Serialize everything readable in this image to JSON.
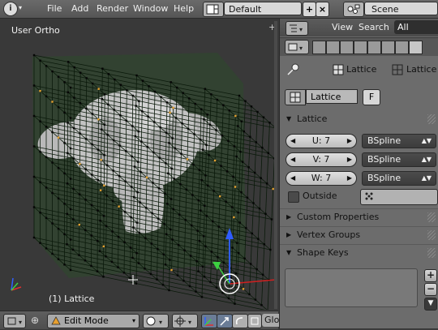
{
  "topbar": {
    "menus": [
      "File",
      "Add",
      "Render",
      "Window",
      "Help"
    ],
    "screen_layout": "Default",
    "add_symbol": "+",
    "remove_symbol": "×",
    "scene": "Scene"
  },
  "viewport": {
    "view_label": "User Ortho",
    "selection_label": "(1) Lattice"
  },
  "viewport_header": {
    "mode": "Edit Mode",
    "truncated_label": "Glo"
  },
  "properties": {
    "header_links": [
      "View",
      "Search"
    ],
    "scenes_button": "All Scenes",
    "breadcrumb": [
      "Lattice",
      "Lattice"
    ],
    "datablock_name": "Lattice",
    "fake_user": "F",
    "panels": {
      "lattice": "Lattice",
      "custom_properties": "Custom Properties",
      "vertex_groups": "Vertex Groups",
      "shape_keys": "Shape Keys"
    },
    "resolution": [
      {
        "label": "U: 7",
        "interp": "BSpline"
      },
      {
        "label": "V: 7",
        "interp": "BSpline"
      },
      {
        "label": "W: 7",
        "interp": "BSpline"
      }
    ],
    "outside_label": "Outside"
  },
  "colors": {
    "lattice_wire": "#0b1a0b",
    "lattice_fill": "#2d4a2a",
    "selected_vertex": "#e3a030",
    "axis_x": "#e03030",
    "axis_y": "#3fd040",
    "axis_z": "#3060ff"
  }
}
